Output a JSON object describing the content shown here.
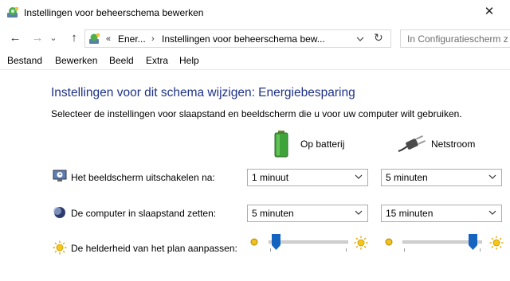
{
  "window": {
    "title": "Instellingen voor beheerschema bewerken",
    "close_glyph": "✕"
  },
  "nav": {
    "back_glyph": "←",
    "forward_glyph": "→",
    "recent_glyph": "⌄",
    "up_glyph": "↑",
    "breadcrumb_chevron": "«",
    "breadcrumb_parent": "Ener...",
    "breadcrumb_sep": "›",
    "breadcrumb_current": "Instellingen voor beheerschema bew...",
    "refresh_glyph": "↻",
    "search_placeholder": "In Configuratiescherm z"
  },
  "menu": {
    "items": [
      "Bestand",
      "Bewerken",
      "Beeld",
      "Extra",
      "Help"
    ]
  },
  "content": {
    "heading": "Instellingen voor dit schema wijzigen: Energiebesparing",
    "description": "Selecteer de instellingen voor slaapstand en beeldscherm die u voor uw computer wilt gebruiken.",
    "col_battery": "Op batterij",
    "col_plugged": "Netstroom",
    "rows": {
      "display": {
        "label": "Het beeldscherm uitschakelen na:",
        "battery_value": "1 minuut",
        "plugged_value": "5 minuten"
      },
      "sleep": {
        "label": "De computer in slaapstand zetten:",
        "battery_value": "5 minuten",
        "plugged_value": "15 minuten"
      },
      "brightness": {
        "label": "De helderheid van het plan aanpassen:",
        "battery_level": 0.05,
        "plugged_level": 0.95
      }
    }
  },
  "colors": {
    "heading": "#1e3287",
    "slider_thumb": "#1565c0"
  }
}
